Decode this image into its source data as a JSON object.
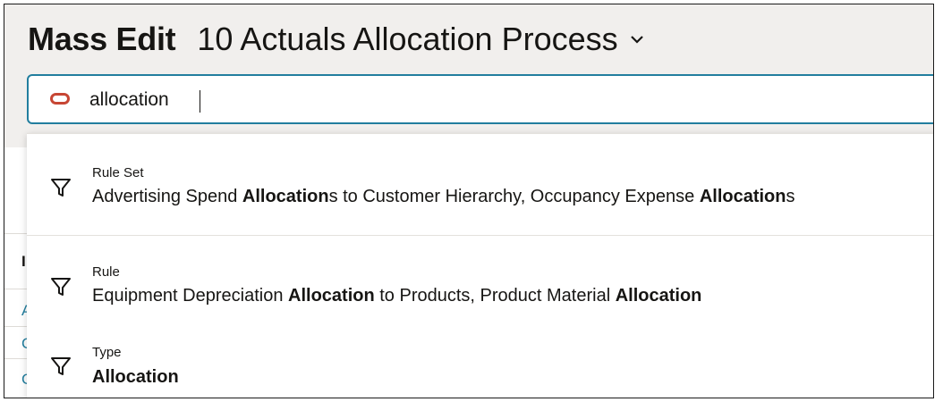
{
  "header": {
    "title_bold": "Mass Edit",
    "title_name": "10 Actuals Allocation Process"
  },
  "search": {
    "value": "allocation"
  },
  "background": {
    "letters": [
      "I",
      "A",
      "C",
      "C"
    ]
  },
  "suggestions": [
    {
      "category": "Rule Set",
      "parts": [
        {
          "t": "Advertising Spend ",
          "b": false
        },
        {
          "t": "Allocation",
          "b": true
        },
        {
          "t": "s to Customer Hierarchy, Occupancy Expense ",
          "b": false
        },
        {
          "t": "Allocation",
          "b": true
        },
        {
          "t": "s",
          "b": false
        }
      ]
    },
    {
      "category": "Rule",
      "parts": [
        {
          "t": "Equipment Depreciation ",
          "b": false
        },
        {
          "t": "Allocation",
          "b": true
        },
        {
          "t": " to Products, Product Material ",
          "b": false
        },
        {
          "t": "Allocation",
          "b": true
        }
      ]
    },
    {
      "category": "Type",
      "parts": [
        {
          "t": "Allocation",
          "b": true
        }
      ]
    }
  ],
  "colors": {
    "header_bg": "#f1efed",
    "focus_border": "#227e9e",
    "oracle_red": "#c74634",
    "link_blue": "#227e9e"
  },
  "icons": {
    "chevron": "chevron-down-icon",
    "logo": "oracle-logo-icon",
    "filter": "filter-icon"
  }
}
